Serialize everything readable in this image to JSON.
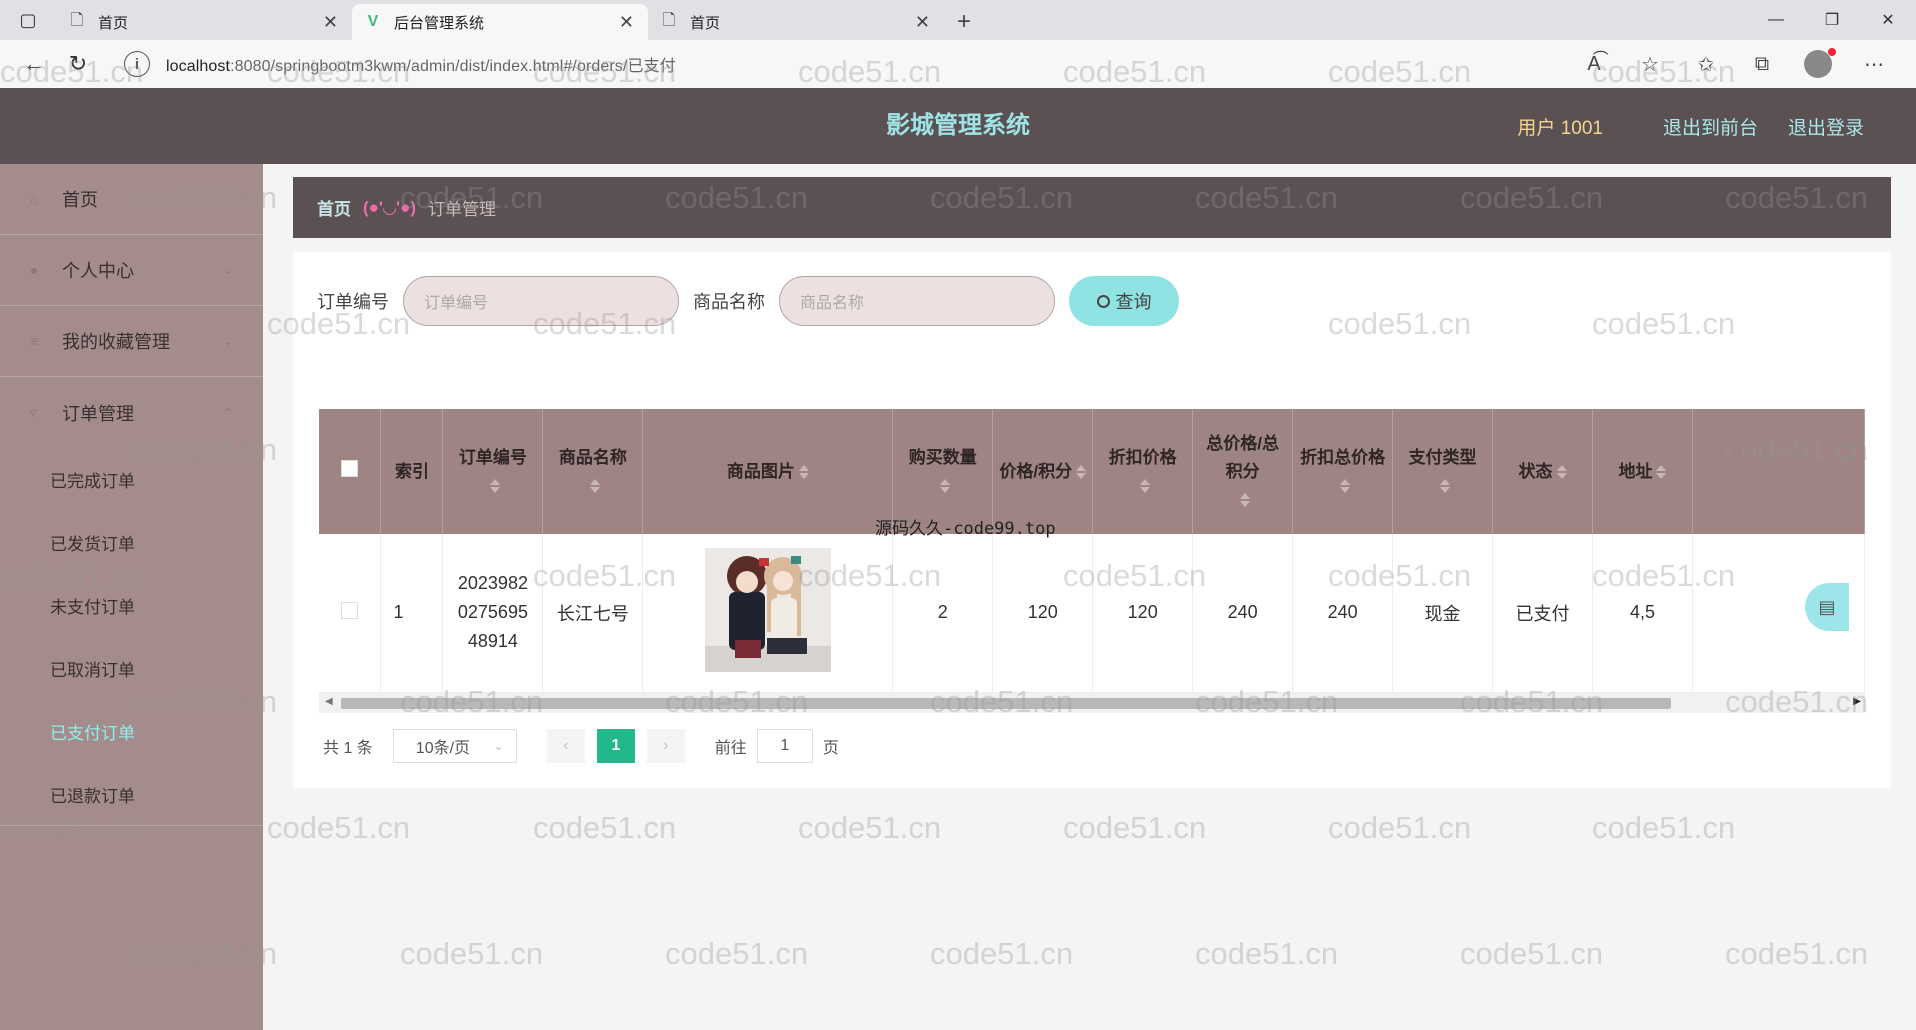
{
  "browser": {
    "tabs": [
      {
        "title": "首页",
        "icon": "page-icon",
        "active": false
      },
      {
        "title": "后台管理系统",
        "icon": "vue-icon",
        "active": true
      },
      {
        "title": "首页",
        "icon": "page-icon",
        "active": false
      }
    ],
    "url_host": "localhost",
    "url_rest": ":8080/springbootm3kwm/admin/dist/index.html#/orders/已支付"
  },
  "header": {
    "title": "影城管理系统",
    "user": "用户 1001",
    "front_link": "退出到前台",
    "logout_link": "退出登录"
  },
  "sidebar": {
    "items": [
      {
        "label": "首页"
      },
      {
        "label": "个人中心"
      },
      {
        "label": "我的收藏管理"
      },
      {
        "label": "订单管理"
      }
    ],
    "sub_items": [
      {
        "label": "已完成订单"
      },
      {
        "label": "已发货订单"
      },
      {
        "label": "未支付订单"
      },
      {
        "label": "已取消订单"
      },
      {
        "label": "已支付订单"
      },
      {
        "label": "已退款订单"
      }
    ]
  },
  "breadcrumb": {
    "home": "首页",
    "sep": "(●'◡'●)",
    "current": "订单管理"
  },
  "search": {
    "order_label": "订单编号",
    "order_placeholder": "订单编号",
    "product_label": "商品名称",
    "product_placeholder": "商品名称",
    "query_btn": "查询"
  },
  "table": {
    "columns": [
      "索引",
      "订单编号",
      "商品名称",
      "商品图片",
      "购买数量",
      "价格/积分",
      "折扣价格",
      "总价格/总积分",
      "折扣总价格",
      "支付类型",
      "状态",
      "地址"
    ],
    "rows": [
      {
        "index": "1",
        "order_no": "20239820275695 48914",
        "order_no_lines": [
          "2023982",
          "0275695",
          "48914"
        ],
        "product": "长江七号",
        "qty": "2",
        "price": "120",
        "discount_price": "120",
        "total": "240",
        "discount_total": "240",
        "pay_type": "现金",
        "status": "已支付",
        "address": "4,5"
      }
    ]
  },
  "overlay_text": "源码久久-code99.top",
  "pagination": {
    "total": "共 1 条",
    "page_size": "10条/页",
    "current": "1",
    "goto": "前往",
    "page_unit": "页",
    "jump_value": "1"
  },
  "watermark": "code51.cn"
}
